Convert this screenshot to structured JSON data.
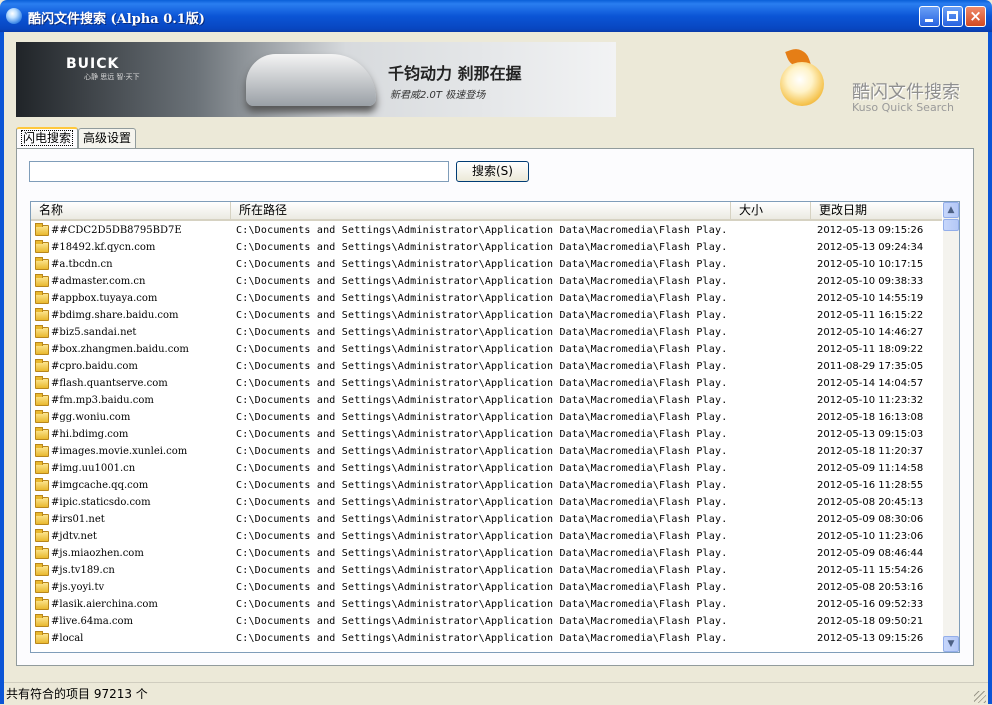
{
  "window": {
    "title": "酷闪文件搜索 (Alpha 0.1版)"
  },
  "banner": {
    "brand": "BUICK",
    "brand_sub": "心静 思远 智·天下",
    "headline": "千钧动力 刹那在握",
    "subline": "新君威2.0T 极速登场"
  },
  "logo": {
    "title": "酷闪文件搜索",
    "subtitle": "Kuso Quick Search"
  },
  "tabs": [
    {
      "label": "闪电搜索",
      "active": true
    },
    {
      "label": "高级设置",
      "active": false
    }
  ],
  "search": {
    "value": "",
    "button_label": "搜索(S)"
  },
  "columns": [
    "名称",
    "所在路径",
    "大小",
    "更改日期"
  ],
  "rows": [
    {
      "name": "##CDC2D5DB8795BD7E",
      "path": "C:\\Documents and Settings\\Administrator\\Application Data\\Macromedia\\Flash Play...",
      "size": "",
      "date": "2012-05-13 09:15:26"
    },
    {
      "name": "#18492.kf.qycn.com",
      "path": "C:\\Documents and Settings\\Administrator\\Application Data\\Macromedia\\Flash Play...",
      "size": "",
      "date": "2012-05-13 09:24:34"
    },
    {
      "name": "#a.tbcdn.cn",
      "path": "C:\\Documents and Settings\\Administrator\\Application Data\\Macromedia\\Flash Play...",
      "size": "",
      "date": "2012-05-10 10:17:15"
    },
    {
      "name": "#admaster.com.cn",
      "path": "C:\\Documents and Settings\\Administrator\\Application Data\\Macromedia\\Flash Play...",
      "size": "",
      "date": "2012-05-10 09:38:33"
    },
    {
      "name": "#appbox.tuyaya.com",
      "path": "C:\\Documents and Settings\\Administrator\\Application Data\\Macromedia\\Flash Play...",
      "size": "",
      "date": "2012-05-10 14:55:19"
    },
    {
      "name": "#bdimg.share.baidu.com",
      "path": "C:\\Documents and Settings\\Administrator\\Application Data\\Macromedia\\Flash Play...",
      "size": "",
      "date": "2012-05-11 16:15:22"
    },
    {
      "name": "#biz5.sandai.net",
      "path": "C:\\Documents and Settings\\Administrator\\Application Data\\Macromedia\\Flash Play...",
      "size": "",
      "date": "2012-05-10 14:46:27"
    },
    {
      "name": "#box.zhangmen.baidu.com",
      "path": "C:\\Documents and Settings\\Administrator\\Application Data\\Macromedia\\Flash Play...",
      "size": "",
      "date": "2012-05-11 18:09:22"
    },
    {
      "name": "#cpro.baidu.com",
      "path": "C:\\Documents and Settings\\Administrator\\Application Data\\Macromedia\\Flash Play...",
      "size": "",
      "date": "2011-08-29 17:35:05"
    },
    {
      "name": "#flash.quantserve.com",
      "path": "C:\\Documents and Settings\\Administrator\\Application Data\\Macromedia\\Flash Play...",
      "size": "",
      "date": "2012-05-14 14:04:57"
    },
    {
      "name": "#fm.mp3.baidu.com",
      "path": "C:\\Documents and Settings\\Administrator\\Application Data\\Macromedia\\Flash Play...",
      "size": "",
      "date": "2012-05-10 11:23:32"
    },
    {
      "name": "#gg.woniu.com",
      "path": "C:\\Documents and Settings\\Administrator\\Application Data\\Macromedia\\Flash Play...",
      "size": "",
      "date": "2012-05-18 16:13:08"
    },
    {
      "name": "#hi.bdimg.com",
      "path": "C:\\Documents and Settings\\Administrator\\Application Data\\Macromedia\\Flash Play...",
      "size": "",
      "date": "2012-05-13 09:15:03"
    },
    {
      "name": "#images.movie.xunlei.com",
      "path": "C:\\Documents and Settings\\Administrator\\Application Data\\Macromedia\\Flash Play...",
      "size": "",
      "date": "2012-05-18 11:20:37"
    },
    {
      "name": "#img.uu1001.cn",
      "path": "C:\\Documents and Settings\\Administrator\\Application Data\\Macromedia\\Flash Play...",
      "size": "",
      "date": "2012-05-09 11:14:58"
    },
    {
      "name": "#imgcache.qq.com",
      "path": "C:\\Documents and Settings\\Administrator\\Application Data\\Macromedia\\Flash Play...",
      "size": "",
      "date": "2012-05-16 11:28:55"
    },
    {
      "name": "#ipic.staticsdo.com",
      "path": "C:\\Documents and Settings\\Administrator\\Application Data\\Macromedia\\Flash Play...",
      "size": "",
      "date": "2012-05-08 20:45:13"
    },
    {
      "name": "#irs01.net",
      "path": "C:\\Documents and Settings\\Administrator\\Application Data\\Macromedia\\Flash Play...",
      "size": "",
      "date": "2012-05-09 08:30:06"
    },
    {
      "name": "#jdtv.net",
      "path": "C:\\Documents and Settings\\Administrator\\Application Data\\Macromedia\\Flash Play...",
      "size": "",
      "date": "2012-05-10 11:23:06"
    },
    {
      "name": "#js.miaozhen.com",
      "path": "C:\\Documents and Settings\\Administrator\\Application Data\\Macromedia\\Flash Play...",
      "size": "",
      "date": "2012-05-09 08:46:44"
    },
    {
      "name": "#js.tv189.cn",
      "path": "C:\\Documents and Settings\\Administrator\\Application Data\\Macromedia\\Flash Play...",
      "size": "",
      "date": "2012-05-11 15:54:26"
    },
    {
      "name": "#js.yoyi.tv",
      "path": "C:\\Documents and Settings\\Administrator\\Application Data\\Macromedia\\Flash Play...",
      "size": "",
      "date": "2012-05-08 20:53:16"
    },
    {
      "name": "#lasik.aierchina.com",
      "path": "C:\\Documents and Settings\\Administrator\\Application Data\\Macromedia\\Flash Play...",
      "size": "",
      "date": "2012-05-16 09:52:33"
    },
    {
      "name": "#live.64ma.com",
      "path": "C:\\Documents and Settings\\Administrator\\Application Data\\Macromedia\\Flash Play...",
      "size": "",
      "date": "2012-05-18 09:50:21"
    },
    {
      "name": "#local",
      "path": "C:\\Documents and Settings\\Administrator\\Application Data\\Macromedia\\Flash Play...",
      "size": "",
      "date": "2012-05-13 09:15:26"
    }
  ],
  "status": {
    "text": "共有符合的项目 97213 个"
  },
  "icons": [
    "app-icon",
    "minimize-icon",
    "maximize-icon",
    "close-icon",
    "folder-icon",
    "scroll-up-icon",
    "scroll-down-icon",
    "resize-grip-icon"
  ]
}
